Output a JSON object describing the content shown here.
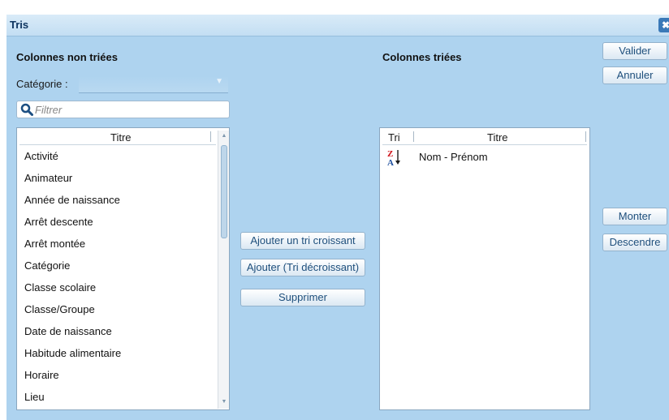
{
  "window": {
    "title": "Tris",
    "close_icon": "close-icon",
    "close_glyph": "✖"
  },
  "left": {
    "title": "Colonnes non triées",
    "category_label": "Catégorie :",
    "category_value": "",
    "filter_placeholder": "Filtrer",
    "filter_value": "",
    "filter_icon": "search-icon",
    "column_header": "Titre",
    "items": [
      "Activité",
      "Animateur",
      "Année de naissance",
      "Arrêt descente",
      "Arrêt montée",
      "Catégorie",
      "Classe scolaire",
      "Classe/Groupe",
      "Date de naissance",
      "Habitude alimentaire",
      "Horaire",
      "Lieu"
    ],
    "scroll_fraction": 0.0
  },
  "middle": {
    "add_asc": "Ajouter un tri croissant",
    "add_desc": "Ajouter (Tri décroissant)",
    "remove": "Supprimer"
  },
  "right": {
    "title": "Colonnes triées",
    "col_sort": "Tri",
    "col_title": "Titre",
    "rows": [
      {
        "direction": "descending",
        "icon": "sort-descending-icon",
        "title": "Nom - Prénom"
      }
    ]
  },
  "actions": {
    "validate": "Valider",
    "cancel": "Annuler",
    "move_up": "Monter",
    "move_down": "Descendre"
  },
  "colors": {
    "background": "#aed3ef",
    "titlebar": "#cfe5f6",
    "accent": "#1e4f7c",
    "sort_z": "#d0141b",
    "sort_a": "#1e4f9e"
  }
}
